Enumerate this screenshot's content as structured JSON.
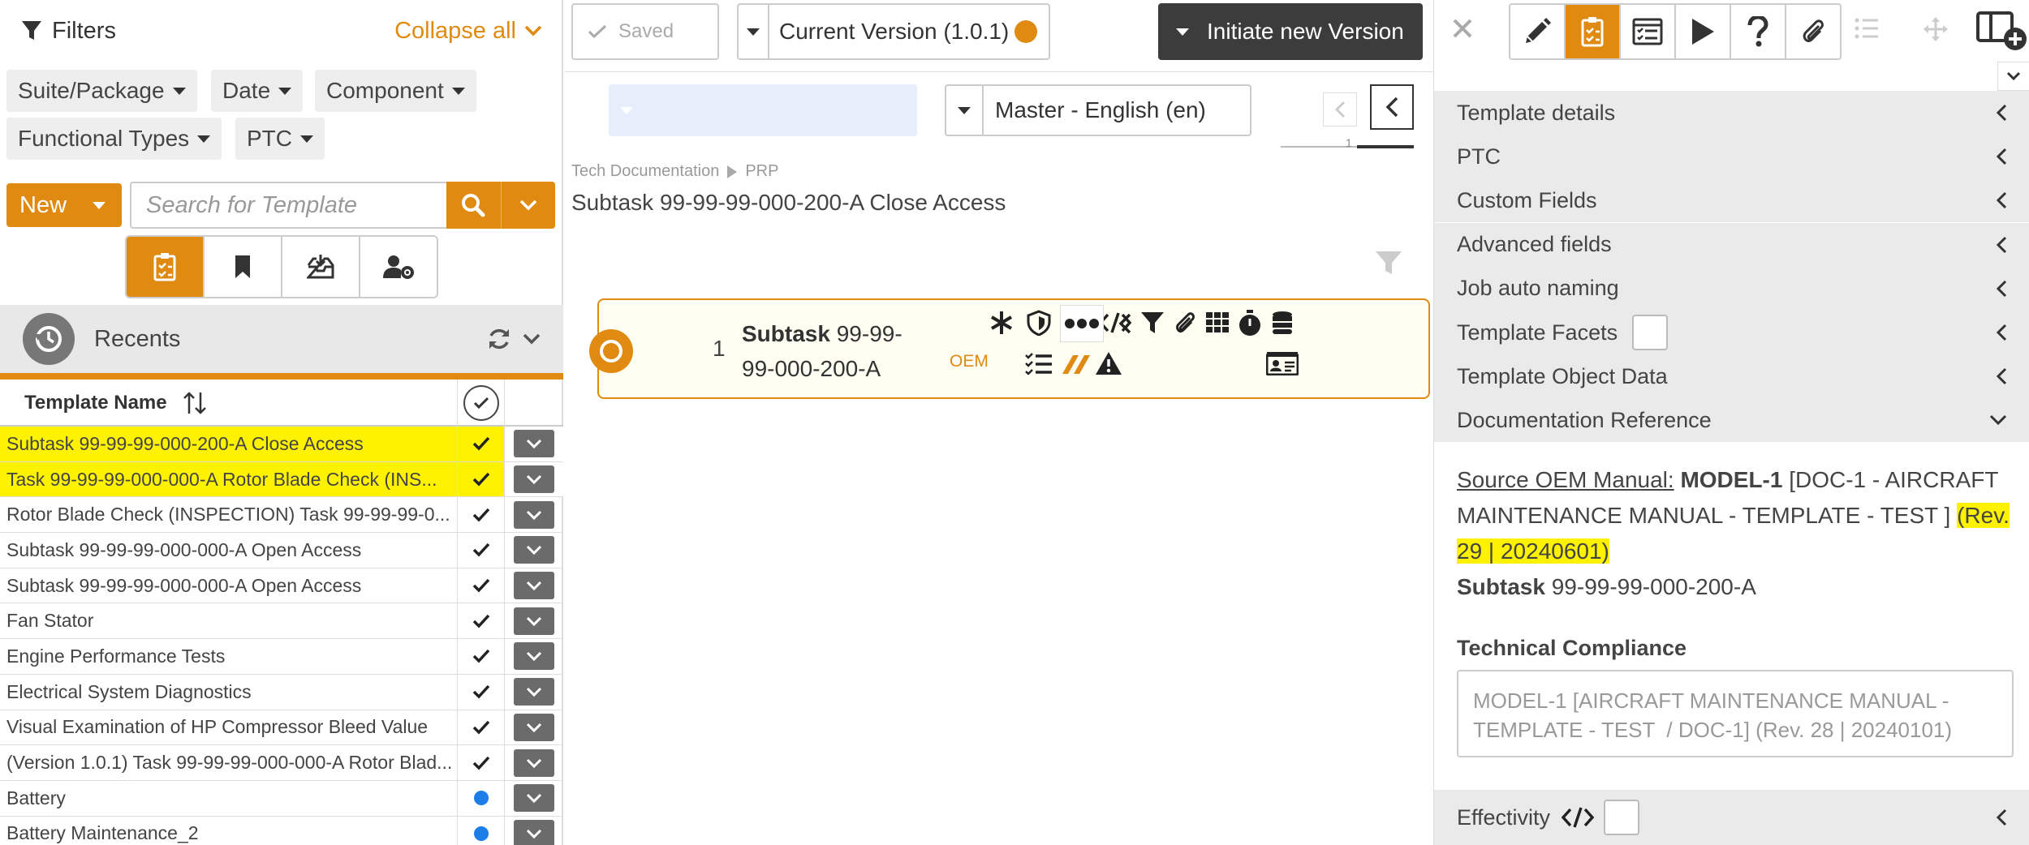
{
  "filters": {
    "title": "Filters",
    "collapse_label": "Collapse all",
    "chips": [
      "Suite/Package",
      "Date",
      "Component",
      "Functional Types",
      "PTC"
    ]
  },
  "search": {
    "new_label": "New",
    "placeholder": "Search for Template"
  },
  "recents": {
    "label": "Recents"
  },
  "table": {
    "header_name": "Template Name",
    "rows": [
      {
        "name": "Subtask 99-99-99-000-200-A Close Access",
        "status": "check",
        "highlight": true
      },
      {
        "name": "Task 99-99-99-000-000-A Rotor Blade Check (INS...",
        "status": "check",
        "highlight": true
      },
      {
        "name": "Rotor Blade Check (INSPECTION) Task 99-99-99-0...",
        "status": "check",
        "highlight": false
      },
      {
        "name": "Subtask 99-99-99-000-000-A Open Access",
        "status": "check",
        "highlight": false
      },
      {
        "name": "Subtask 99-99-99-000-000-A Open Access",
        "status": "check",
        "highlight": false
      },
      {
        "name": "Fan Stator",
        "status": "check",
        "highlight": false
      },
      {
        "name": "Engine Performance Tests",
        "status": "check",
        "highlight": false
      },
      {
        "name": "Electrical System Diagnostics",
        "status": "check",
        "highlight": false
      },
      {
        "name": "Visual Examination of HP Compressor Bleed Value",
        "status": "check",
        "highlight": false
      },
      {
        "name": "(Version 1.0.1) Task 99-99-99-000-000-A Rotor Blad...",
        "status": "check",
        "highlight": false
      },
      {
        "name": "Battery",
        "status": "dot",
        "highlight": false
      },
      {
        "name": "Battery Maintenance_2",
        "status": "dot",
        "highlight": false
      }
    ]
  },
  "center": {
    "saved_label": "Saved",
    "version_label": "Current Version (1.0.1)",
    "initiate_label": "Initiate new Version",
    "language_label": "Master - English (en)",
    "pager_number": "1",
    "breadcrumb": [
      "Tech Documentation",
      "PRP"
    ],
    "doc_title": "Subtask 99-99-99-000-200-A Close Access",
    "card": {
      "number": "1",
      "type_label": "Subtask",
      "code": "99-99-99-000-200-A",
      "tag": "OEM"
    }
  },
  "right": {
    "sections": [
      "Template details",
      "PTC",
      "Custom Fields",
      "Advanced fields",
      "Job auto naming",
      "Template Facets",
      "Template Object Data",
      "Documentation Reference"
    ],
    "doc_ref": {
      "source_label": "Source OEM Manual:",
      "model": "MODEL-1",
      "manual": "[DOC-1 - AIRCRAFT MAINTENANCE MANUAL - TEMPLATE - TEST ]",
      "rev": "(Rev. 29 | 20240601)",
      "subtask_label": "Subtask",
      "subtask_code": "99-99-99-000-200-A"
    },
    "technical_compliance_label": "Technical Compliance",
    "technical_compliance_value": "MODEL-1 [AIRCRAFT MAINTENANCE MANUAL - TEMPLATE - TEST  / DOC-1] (Rev. 28 | 20240101)",
    "effectivity_label": "Effectivity"
  },
  "colors": {
    "accent": "#e08a12",
    "highlight": "#fff200",
    "dark_button": "#3c3c3c",
    "status_blue": "#1e7ee8"
  }
}
